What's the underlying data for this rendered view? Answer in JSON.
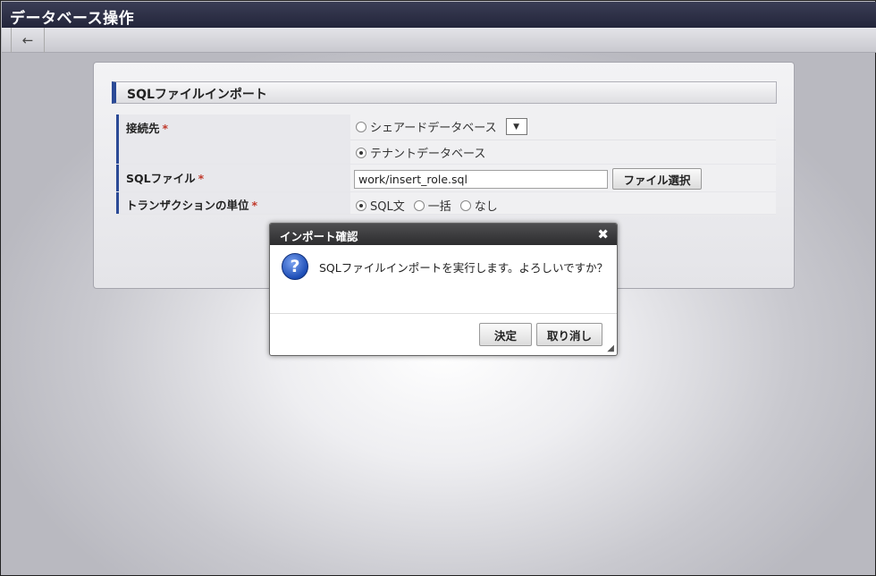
{
  "window": {
    "title": "データベース操作"
  },
  "toolbar": {
    "back_icon": "arrow-left-icon",
    "back_glyph": "←"
  },
  "form": {
    "section_title": "SQLファイルインポート",
    "required_mark": "*",
    "connection": {
      "label": "接続先",
      "options": [
        {
          "label": "シェアードデータベース",
          "selected": false
        },
        {
          "label": "テナントデータベース",
          "selected": true
        }
      ],
      "dropdown_glyph": "▼"
    },
    "sql_file": {
      "label": "SQLファイル",
      "value": "work/insert_role.sql",
      "select_button": "ファイル選択"
    },
    "transaction_unit": {
      "label": "トランザクションの単位",
      "options": [
        {
          "label": "SQL文",
          "selected": true
        },
        {
          "label": "一括",
          "selected": false
        },
        {
          "label": "なし",
          "selected": false
        }
      ]
    }
  },
  "dialog": {
    "title": "インポート確認",
    "close_glyph": "✖",
    "icon": "question-icon",
    "icon_glyph": "?",
    "message": "SQLファイルインポートを実行します。よろしいですか？",
    "ok_button": "決定",
    "cancel_button": "取り消し",
    "resize_glyph": "◢"
  },
  "colors": {
    "accent": "#2b4a96",
    "title_bar": "#2a2c42",
    "required": "#c0392b"
  }
}
